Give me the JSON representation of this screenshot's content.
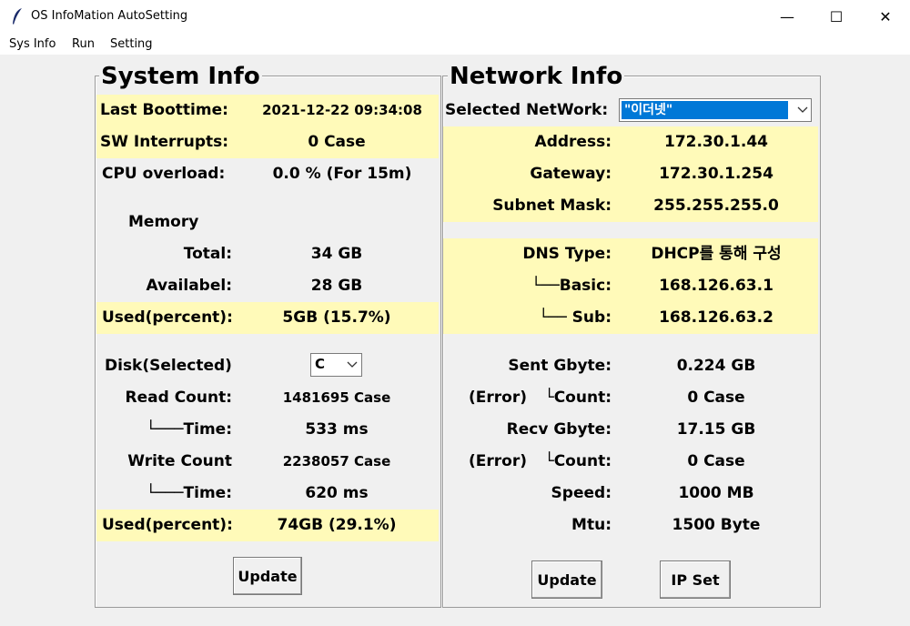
{
  "window": {
    "title": "OS InfoMation AutoSetting",
    "minimize": "—",
    "maximize": "☐",
    "close": "✕"
  },
  "menu": [
    "Sys Info",
    "Run",
    "Setting"
  ],
  "system": {
    "title": "System Info",
    "last_boot_label": "Last Boottime:",
    "last_boot_value": "2021-12-22 09:34:08",
    "sw_int_label": "SW Interrupts:",
    "sw_int_value": "0 Case",
    "cpu_label": "CPU overload:",
    "cpu_value": "0.0 % (For 15m)",
    "memory_label": "Memory",
    "total_label": "Total:",
    "total_value": "34 GB",
    "avail_label": "Availabel:",
    "avail_value": "28 GB",
    "mem_used_label": "Used(percent):",
    "mem_used_value": "5GB (15.7%)",
    "disk_label": "Disk(Selected)",
    "disk_selected": "C",
    "read_count_label": "Read Count:",
    "read_count_value": "1481695 Case",
    "read_time_label": "└───Time:",
    "read_time_value": "533 ms",
    "write_count_label": "Write Count",
    "write_count_value": "2238057 Case",
    "write_time_label": "└───Time:",
    "write_time_value": "620 ms",
    "disk_used_label": "Used(percent):",
    "disk_used_value": "74GB (29.1%)",
    "update_button": "Update"
  },
  "network": {
    "title": "Network Info",
    "selected_label": "Selected NetWork:",
    "selected_value": "\"이더넷\"",
    "address_label": "Address:",
    "address_value": "172.30.1.44",
    "gateway_label": "Gateway:",
    "gateway_value": "172.30.1.254",
    "subnet_label": "Subnet Mask:",
    "subnet_value": "255.255.255.0",
    "dns_type_label": "DNS Type:",
    "dns_type_value": "DHCP를 통해 구성",
    "dns_basic_label": "└──Basic:",
    "dns_basic_value": "168.126.63.1",
    "dns_sub_label": "└── Sub:",
    "dns_sub_value": "168.126.63.2",
    "sent_label": "Sent Gbyte:",
    "sent_value": "0.224 GB",
    "sent_err_prefix": "(Error)",
    "sent_err_label": "└Count:",
    "sent_err_value": "0 Case",
    "recv_label": "Recv Gbyte:",
    "recv_value": "17.15 GB",
    "recv_err_prefix": "(Error)",
    "recv_err_label": "└Count:",
    "recv_err_value": "0 Case",
    "speed_label": "Speed:",
    "speed_value": "1000 MB",
    "mtu_label": "Mtu:",
    "mtu_value": "1500 Byte",
    "update_button": "Update",
    "ipset_button": "IP Set"
  },
  "colors": {
    "highlight": "#fffab9",
    "selection": "#0078d7"
  }
}
